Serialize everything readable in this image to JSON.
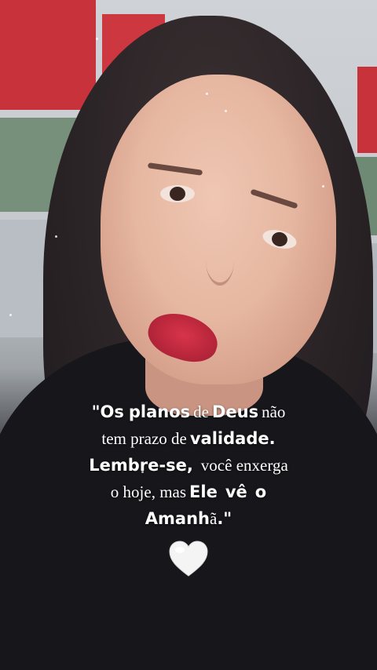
{
  "quote": {
    "line1": {
      "a": "\"Os",
      "b": "planos",
      "c": "de",
      "d": "Deus",
      "e": "não"
    },
    "line2": {
      "a": "tem prazo de",
      "b": "validade."
    },
    "line3": {
      "a": "Lembre-se,",
      "b": "você enxerga"
    },
    "line4": {
      "a": "o hoje, mas",
      "b": "Ele",
      "c": "vê",
      "d": "o"
    },
    "line5": {
      "a": "Amanh",
      "b": "ã",
      "c": ".\""
    }
  },
  "colors": {
    "text": "#ffffff",
    "heart": "#f4f4f4"
  },
  "icon": "white-heart-icon"
}
